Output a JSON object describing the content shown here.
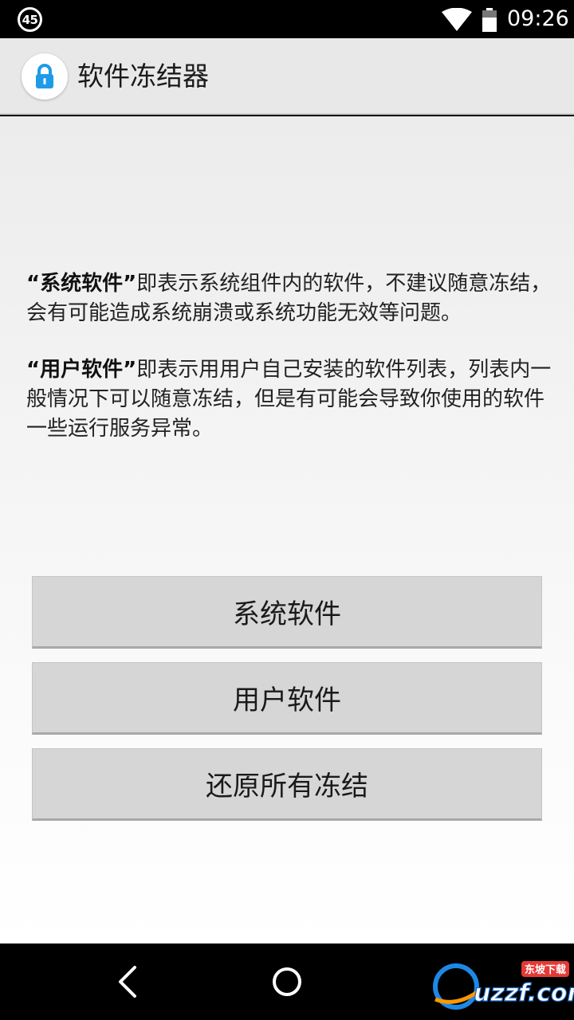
{
  "status_bar": {
    "badge_text": "45",
    "time": "09:26",
    "icons": [
      "notification-count-badge",
      "wifi-icon",
      "battery-icon"
    ]
  },
  "app_bar": {
    "title": "软件冻结器",
    "icon": "lock-icon",
    "accent_color": "#1e9be8"
  },
  "description": {
    "system": {
      "term": "“系统软件”",
      "text": "即表示系统组件内的软件，不建议随意冻结，会有可能造成系统崩溃或系统功能无效等问题。"
    },
    "user": {
      "term": "“用户软件”",
      "text": "即表示用用户自己安装的软件列表，列表内一般情况下可以随意冻结，但是有可能会导致你使用的软件一些运行服务异常。"
    }
  },
  "buttons": {
    "system_label": "系统软件",
    "user_label": "用户软件",
    "restore_label": "还原所有冻结"
  },
  "nav_bar": {
    "icons": [
      "back-icon",
      "home-icon"
    ]
  },
  "watermark": {
    "brand": "uzzf.com",
    "tag": "东坡下载"
  }
}
